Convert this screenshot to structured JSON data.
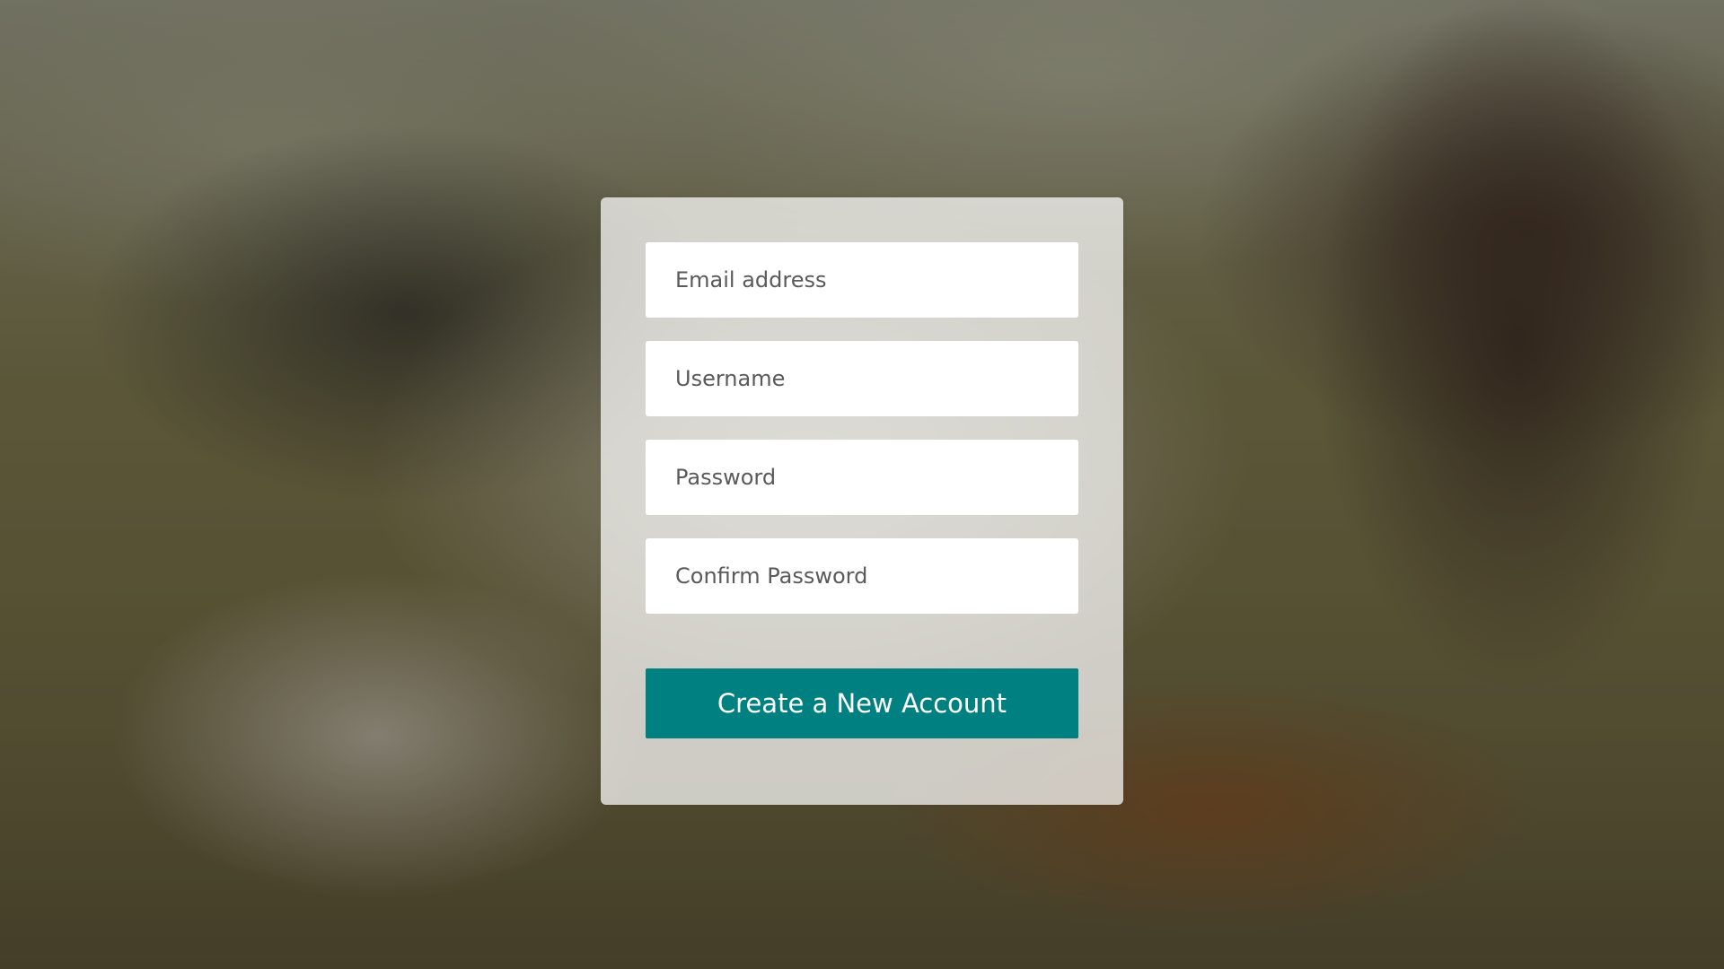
{
  "signup_form": {
    "email_placeholder": "Email address",
    "username_placeholder": "Username",
    "password_placeholder": "Password",
    "confirm_password_placeholder": "Confirm Password",
    "submit_label": "Create a New Account"
  },
  "colors": {
    "button_background": "#008080",
    "button_text": "#ffffff",
    "card_background": "rgba(255,255,255,0.72)"
  }
}
